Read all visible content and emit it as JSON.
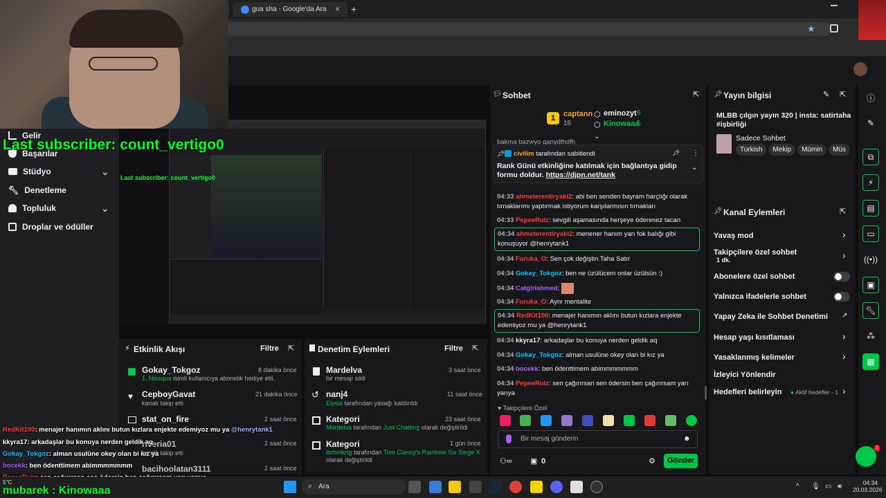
{
  "browser": {
    "tab_title": "gua sha - Google'da Ara",
    "new_tab": "+",
    "close": "×"
  },
  "overlay": {
    "last_subscriber_label": "Last subscriber:",
    "last_subscriber_name": "count_vertigo0",
    "mubarek_text": "mubarek : Kinowaaa",
    "mini_sub_label": "Last subscriber:",
    "mini_sub_name": "count_vertigo0"
  },
  "leftnav": {
    "items": [
      {
        "label": "Gelir",
        "icon": "chart-icon"
      },
      {
        "label": "Başarılar",
        "icon": "trophy-icon"
      },
      {
        "label": "Stüdyo",
        "icon": "video-icon"
      },
      {
        "label": "Denetleme",
        "icon": "wrench-icon"
      },
      {
        "label": "Topluluk",
        "icon": "people-icon"
      },
      {
        "label": "Droplar ve ödüller",
        "icon": "gift-icon"
      }
    ]
  },
  "activity": {
    "title": "Etkinlik Akışı",
    "filter": "Filtre",
    "items": [
      {
        "user": "Gokay_Tokgoz",
        "time": "8 dakika önce",
        "sub_pre": "1, ",
        "sub_name": "Nissqua",
        "sub_post": " isimli kullanıcıya abonelik hediye etti."
      },
      {
        "user": "CepboyGavat",
        "time": "21 dakika önce",
        "sub_pre": "kanalı takip etti",
        "sub_name": "",
        "sub_post": ""
      },
      {
        "user": "stat_on_fire",
        "time": "2 saat önce",
        "sub_pre": "",
        "sub_name": "",
        "sub_post": ""
      },
      {
        "user": "riveria01",
        "time": "2 saat önce",
        "sub_pre": "kanalı takip etti",
        "sub_name": "",
        "sub_post": ""
      },
      {
        "user": "bacihoolatan3111",
        "time": "2 saat önce",
        "sub_pre": "",
        "sub_name": "",
        "sub_post": ""
      }
    ]
  },
  "moderation": {
    "title": "Denetim Eylemleri",
    "filter": "Filtre",
    "items": [
      {
        "user": "Mardelva",
        "time": "3 saat önce",
        "sub_pre": "bir mesajı sildi",
        "sub_name": "",
        "sub_mid": "",
        "sub_post": ""
      },
      {
        "user": "nanj4",
        "time": "11 saat önce",
        "sub_pre": "",
        "sub_name": "Elysia",
        "sub_mid": " tarafından yasağı kaldırıldı",
        "sub_post": ""
      },
      {
        "user": "Kategori",
        "time": "23 saat önce",
        "sub_pre": "",
        "sub_name": "Mardelva",
        "sub_mid": " tarafından ",
        "sub_post": "Just Chatting"
      },
      {
        "user": "Kategori",
        "time": "1 gün önce",
        "sub_pre": "",
        "sub_name": "ibrhmkrtg",
        "sub_mid": " tarafından ",
        "sub_post": "Tom Clancy's Rainbow Six Siege X"
      }
    ],
    "suffix_changed": " olarak değiştirildi",
    "suffix_changed2": "olarak değiştirildi"
  },
  "chat": {
    "title": "Sohbet",
    "leader1": "captann",
    "leader1_count": "16",
    "leader2": "eminozyt",
    "leader2_count": "6",
    "leader3": "Kinowaaa",
    "leader3_count": "5",
    "cut_line": "bakma bazwyo ganydfhdfh",
    "pinned_by": "civilim",
    "pinned_suffix": " tarafından sabitlendi",
    "pinned_text": "Rank Günü etkinliğine katılmak için bağlantıya gidip formu doldur. ",
    "pinned_link": "https://djpn.net/tank",
    "messages": [
      {
        "time": "04:33",
        "user": "ahmeterentiryaki2",
        "color": "#ff3b3b",
        "text": "abi ben senden bayram harçlığı olarak tırnaklarımı yaptırmak istiyorum karşılarmısın tırnakları",
        "hl": false
      },
      {
        "time": "04:33",
        "user": "PepeeRulz",
        "color": "#ff3b3b",
        "text": "sevgili aşamasında herşeye ödenmez tacan",
        "hl": false
      },
      {
        "time": "04:34",
        "user": "ahmeterentiryaki2",
        "color": "#ff3b3b",
        "text": "menener hanım yarı fok balığı gibi konuşuyor @henrytank1",
        "hl": true
      },
      {
        "time": "04:34",
        "user": "Furuka_O",
        "color": "#ff3b3b",
        "text": "Sen çok değiştin Taha Satır",
        "hl": false
      },
      {
        "time": "04:34",
        "user": "Gokay_Tokgoz",
        "color": "#00c8ff",
        "text": "ben ne üzülücem onlar üzülsün :)",
        "hl": false
      },
      {
        "time": "04:34",
        "user": "Catgirlahmed",
        "color": "#b05cff",
        "text": "",
        "hl": false
      },
      {
        "time": "04:34",
        "user": "Furuka_O",
        "color": "#ff3b3b",
        "text": "Aynı mentalite",
        "hl": false
      },
      {
        "time": "04:34",
        "user": "RedKit100",
        "color": "#ff3b3b",
        "text": "menajer hanımın aklını butun kızlara enjekte edemiyoz mu ya @henrytank1",
        "hl": true
      },
      {
        "time": "04:34",
        "user": "kkyra17",
        "color": "#efeff1",
        "text": "arkadaşlar bu konuya nerden geldik aq",
        "hl": false
      },
      {
        "time": "04:34",
        "user": "Gokay_Tokgoz",
        "color": "#00c8ff",
        "text": "alman usulüne okey olan bi kız ya",
        "hl": false
      },
      {
        "time": "04:34",
        "user": "bocekk",
        "color": "#b05cff",
        "text": "ben ödenttimem abimmmmmmm",
        "hl": false
      },
      {
        "time": "04:34",
        "user": "PepeeRulz",
        "color": "#ff3b3b",
        "text": "sen çağırırsan sen ödersin ben çağırırsam yarı yarıya",
        "hl": false
      }
    ],
    "follower_only": "Takipçilere Özel",
    "input_placeholder": "Bir mesaj gönderin",
    "points": "0",
    "send": "Gönder"
  },
  "info": {
    "title": "Yayın bilgisi",
    "stream_title": "MLBB çılgın yayın 320 | insta: satirtaha #işbirliği",
    "category": "Sadece Sohbet",
    "tags": [
      "Turkish",
      "Mekip",
      "Mümin",
      "Müs"
    ]
  },
  "actions": {
    "title": "Kanal Eylemleri",
    "items": [
      {
        "label": "Yavaş mod",
        "control": "chevron"
      },
      {
        "label": "Takipçilere özel sohbet",
        "sub": "1 dk.",
        "control": "chevron"
      },
      {
        "label": "Abonelere özel sohbet",
        "control": "toggle"
      },
      {
        "label": "Yalnızca ifadelerle sohbet",
        "control": "toggle"
      },
      {
        "label": "Yapay Zeka ile Sohbet Denetimi",
        "control": "external"
      },
      {
        "label": "Hesap yaşı kısıtlaması",
        "control": "chevron"
      },
      {
        "label": "Yasaklanmış kelimeler",
        "control": "chevron"
      },
      {
        "label": "İzleyici Yönlendir",
        "control": "none"
      },
      {
        "label": "Hedefleri belirleyin",
        "extra": "Aktif hedefler - 1",
        "control": "chevron"
      }
    ]
  },
  "overlay_chat": [
    {
      "user": "RedKit100",
      "color": "#ff3b3b",
      "text": ": menajer hanımın aklını butun kızlara enjekte edemiyoz mu ya ",
      "mention": "@henrytank1"
    },
    {
      "user": "kkyra17",
      "color": "#ffffff",
      "text": ": arkadaşlar bu konuya nerden geldik aq",
      "mention": ""
    },
    {
      "user": "Gokay_Tokgoz",
      "color": "#00c8ff",
      "text": ": alman usulüne okey olan bi kız ya",
      "mention": ""
    },
    {
      "user": "bocekk",
      "color": "#b05cff",
      "text": ": ben ödenttimem abimmmmmmm",
      "mention": ""
    },
    {
      "user": "PepeeRulz",
      "color": "#ff3b3b",
      "text": ": sen çağırırsan sen ödersin ben çağırırsam yarı yarıya",
      "mention": ""
    }
  ],
  "taskbar": {
    "search": "Ara",
    "weather": "5°C",
    "time": "04:34",
    "date": "20.03.2026"
  },
  "colors": {
    "accent": "#00c747",
    "panel": "#18181b",
    "green_overlay": "#00ff22"
  }
}
